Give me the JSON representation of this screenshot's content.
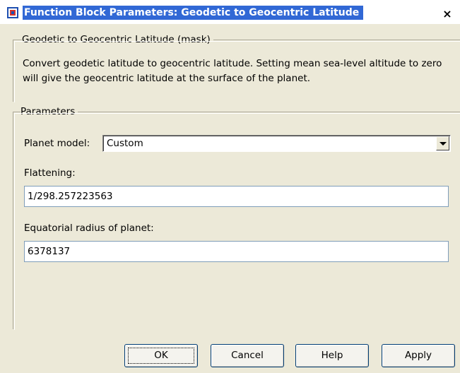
{
  "window": {
    "title": "Function Block Parameters: Geodetic to Geocentric Latitude",
    "close_glyph": "×"
  },
  "mask": {
    "group_title": "Geodetic to Geocentric Latitude (mask)",
    "description": "Convert geodetic latitude to geocentric latitude. Setting mean sea-level altitude to zero will give the geocentric latitude at the surface of the planet."
  },
  "parameters": {
    "group_title": "Parameters",
    "planet_model": {
      "label": "Planet model:",
      "value": "Custom"
    },
    "flattening": {
      "label": "Flattening:",
      "value": "1/298.257223563"
    },
    "equatorial_radius": {
      "label": "Equatorial radius of planet:",
      "value": "6378137"
    }
  },
  "buttons": {
    "ok": "OK",
    "cancel": "Cancel",
    "help": "Help",
    "apply": "Apply"
  },
  "icons": {
    "app": "simulink-block-icon",
    "close": "close-icon",
    "dropdown": "chevron-down-icon"
  },
  "colors": {
    "title_highlight": "#3168d5",
    "dialog_bg": "#ece9d8",
    "button_border": "#003c74"
  }
}
